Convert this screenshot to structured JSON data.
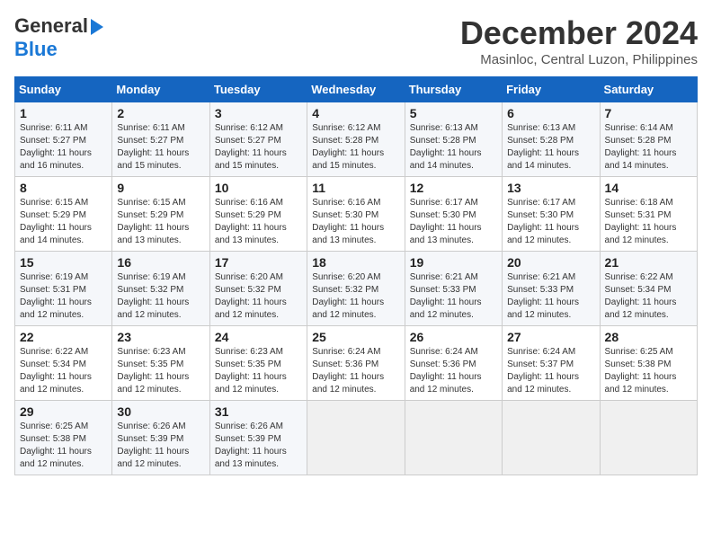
{
  "header": {
    "logo_general": "General",
    "logo_blue": "Blue",
    "month_title": "December 2024",
    "location": "Masinloc, Central Luzon, Philippines"
  },
  "weekdays": [
    "Sunday",
    "Monday",
    "Tuesday",
    "Wednesday",
    "Thursday",
    "Friday",
    "Saturday"
  ],
  "weeks": [
    [
      {
        "day": "1",
        "info": "Sunrise: 6:11 AM\nSunset: 5:27 PM\nDaylight: 11 hours\nand 16 minutes."
      },
      {
        "day": "2",
        "info": "Sunrise: 6:11 AM\nSunset: 5:27 PM\nDaylight: 11 hours\nand 15 minutes."
      },
      {
        "day": "3",
        "info": "Sunrise: 6:12 AM\nSunset: 5:27 PM\nDaylight: 11 hours\nand 15 minutes."
      },
      {
        "day": "4",
        "info": "Sunrise: 6:12 AM\nSunset: 5:28 PM\nDaylight: 11 hours\nand 15 minutes."
      },
      {
        "day": "5",
        "info": "Sunrise: 6:13 AM\nSunset: 5:28 PM\nDaylight: 11 hours\nand 14 minutes."
      },
      {
        "day": "6",
        "info": "Sunrise: 6:13 AM\nSunset: 5:28 PM\nDaylight: 11 hours\nand 14 minutes."
      },
      {
        "day": "7",
        "info": "Sunrise: 6:14 AM\nSunset: 5:28 PM\nDaylight: 11 hours\nand 14 minutes."
      }
    ],
    [
      {
        "day": "8",
        "info": "Sunrise: 6:15 AM\nSunset: 5:29 PM\nDaylight: 11 hours\nand 14 minutes."
      },
      {
        "day": "9",
        "info": "Sunrise: 6:15 AM\nSunset: 5:29 PM\nDaylight: 11 hours\nand 13 minutes."
      },
      {
        "day": "10",
        "info": "Sunrise: 6:16 AM\nSunset: 5:29 PM\nDaylight: 11 hours\nand 13 minutes."
      },
      {
        "day": "11",
        "info": "Sunrise: 6:16 AM\nSunset: 5:30 PM\nDaylight: 11 hours\nand 13 minutes."
      },
      {
        "day": "12",
        "info": "Sunrise: 6:17 AM\nSunset: 5:30 PM\nDaylight: 11 hours\nand 13 minutes."
      },
      {
        "day": "13",
        "info": "Sunrise: 6:17 AM\nSunset: 5:30 PM\nDaylight: 11 hours\nand 12 minutes."
      },
      {
        "day": "14",
        "info": "Sunrise: 6:18 AM\nSunset: 5:31 PM\nDaylight: 11 hours\nand 12 minutes."
      }
    ],
    [
      {
        "day": "15",
        "info": "Sunrise: 6:19 AM\nSunset: 5:31 PM\nDaylight: 11 hours\nand 12 minutes."
      },
      {
        "day": "16",
        "info": "Sunrise: 6:19 AM\nSunset: 5:32 PM\nDaylight: 11 hours\nand 12 minutes."
      },
      {
        "day": "17",
        "info": "Sunrise: 6:20 AM\nSunset: 5:32 PM\nDaylight: 11 hours\nand 12 minutes."
      },
      {
        "day": "18",
        "info": "Sunrise: 6:20 AM\nSunset: 5:32 PM\nDaylight: 11 hours\nand 12 minutes."
      },
      {
        "day": "19",
        "info": "Sunrise: 6:21 AM\nSunset: 5:33 PM\nDaylight: 11 hours\nand 12 minutes."
      },
      {
        "day": "20",
        "info": "Sunrise: 6:21 AM\nSunset: 5:33 PM\nDaylight: 11 hours\nand 12 minutes."
      },
      {
        "day": "21",
        "info": "Sunrise: 6:22 AM\nSunset: 5:34 PM\nDaylight: 11 hours\nand 12 minutes."
      }
    ],
    [
      {
        "day": "22",
        "info": "Sunrise: 6:22 AM\nSunset: 5:34 PM\nDaylight: 11 hours\nand 12 minutes."
      },
      {
        "day": "23",
        "info": "Sunrise: 6:23 AM\nSunset: 5:35 PM\nDaylight: 11 hours\nand 12 minutes."
      },
      {
        "day": "24",
        "info": "Sunrise: 6:23 AM\nSunset: 5:35 PM\nDaylight: 11 hours\nand 12 minutes."
      },
      {
        "day": "25",
        "info": "Sunrise: 6:24 AM\nSunset: 5:36 PM\nDaylight: 11 hours\nand 12 minutes."
      },
      {
        "day": "26",
        "info": "Sunrise: 6:24 AM\nSunset: 5:36 PM\nDaylight: 11 hours\nand 12 minutes."
      },
      {
        "day": "27",
        "info": "Sunrise: 6:24 AM\nSunset: 5:37 PM\nDaylight: 11 hours\nand 12 minutes."
      },
      {
        "day": "28",
        "info": "Sunrise: 6:25 AM\nSunset: 5:38 PM\nDaylight: 11 hours\nand 12 minutes."
      }
    ],
    [
      {
        "day": "29",
        "info": "Sunrise: 6:25 AM\nSunset: 5:38 PM\nDaylight: 11 hours\nand 12 minutes."
      },
      {
        "day": "30",
        "info": "Sunrise: 6:26 AM\nSunset: 5:39 PM\nDaylight: 11 hours\nand 12 minutes."
      },
      {
        "day": "31",
        "info": "Sunrise: 6:26 AM\nSunset: 5:39 PM\nDaylight: 11 hours\nand 13 minutes."
      },
      null,
      null,
      null,
      null
    ]
  ]
}
